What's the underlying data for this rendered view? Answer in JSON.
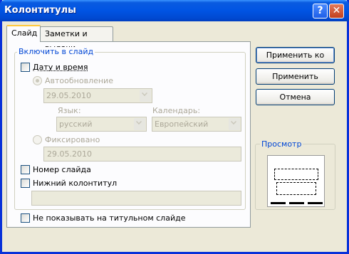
{
  "window": {
    "title": "Колонтитулы"
  },
  "titlebar": {
    "help_glyph": "?",
    "close_glyph": "✕"
  },
  "tabs": [
    {
      "label": "Слайд",
      "active": true
    },
    {
      "label": "Заметки и выдачи",
      "active": false
    }
  ],
  "include": {
    "group_label": "Включить в слайд",
    "date_time_label": "Дату и время",
    "auto_update_label": "Автообновление",
    "auto_date_value": "29.05.2010",
    "language_label": "Язык:",
    "language_value": "русский",
    "calendar_label": "Календарь:",
    "calendar_value": "Европейский",
    "fixed_label": "Фиксировано",
    "fixed_date_value": "29.05.2010",
    "slide_number_label": "Номер слайда",
    "footer_label": "Нижний колонтитул",
    "footer_value": ""
  },
  "dont_show_on_title_label": "Не показывать на титульном слайде",
  "buttons": {
    "apply_all": "Применить ко всем",
    "apply": "Применить",
    "cancel": "Отмена"
  },
  "preview": {
    "label": "Просмотр"
  },
  "colors": {
    "titlebar": "#0054e3",
    "accent": "#0046d5",
    "tab_highlight": "#ffc83c"
  }
}
